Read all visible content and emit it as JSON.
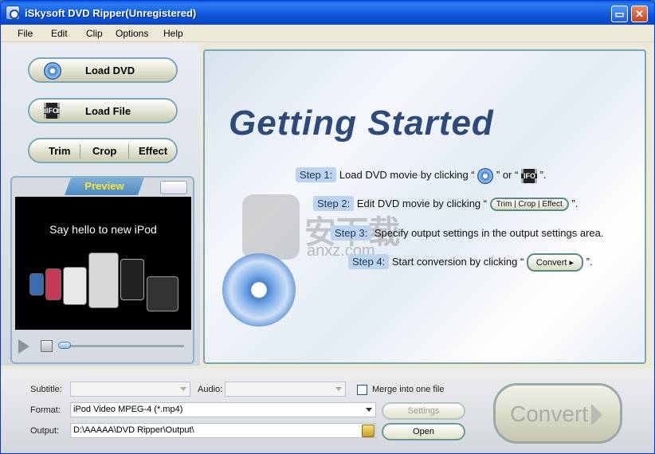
{
  "window": {
    "title": "iSkysoft DVD Ripper(Unregistered)",
    "minimize": "▭",
    "close": "✕"
  },
  "menu": [
    "File",
    "Edit",
    "Clip",
    "Options",
    "Help"
  ],
  "left": {
    "load_dvd": "Load DVD",
    "load_file": "Load File",
    "trim": "Trim",
    "crop": "Crop",
    "effect": "Effect",
    "preview_tab": "Preview",
    "preview_message": "Say hello to new iPod"
  },
  "getting_started": {
    "heading": "Getting Started",
    "steps": [
      {
        "tag": "Step 1:",
        "text": "Load DVD movie by clicking “",
        "mid": "” or “",
        "end": "”."
      },
      {
        "tag": "Step 2:",
        "text": "Edit DVD movie by clicking “",
        "mini": [
          "Trim",
          "Crop",
          "Effect"
        ],
        "end": "”."
      },
      {
        "tag": "Step 3:",
        "text": "Specify output settings in the output settings area."
      },
      {
        "tag": "Step 4:",
        "text": "Start conversion by clicking “",
        "mini": "Convert",
        "end": "”."
      }
    ],
    "icon_ifo": "IFO",
    "watermark": "安下载",
    "watermark_url": "anxz.com"
  },
  "output": {
    "subtitle_label": "Subtitle:",
    "subtitle_value": "",
    "audio_label": "Audio:",
    "audio_value": "",
    "merge_label": "Merge into one file",
    "merge_checked": false,
    "format_label": "Format:",
    "format_value": "iPod Video MPEG-4 (*.mp4)",
    "output_label": "Output:",
    "output_value": "D:\\AAAAA\\DVD Ripper\\Output\\",
    "settings_button": "Settings",
    "open_button": "Open",
    "convert_button": "Convert"
  },
  "preview_progress": 0.0
}
